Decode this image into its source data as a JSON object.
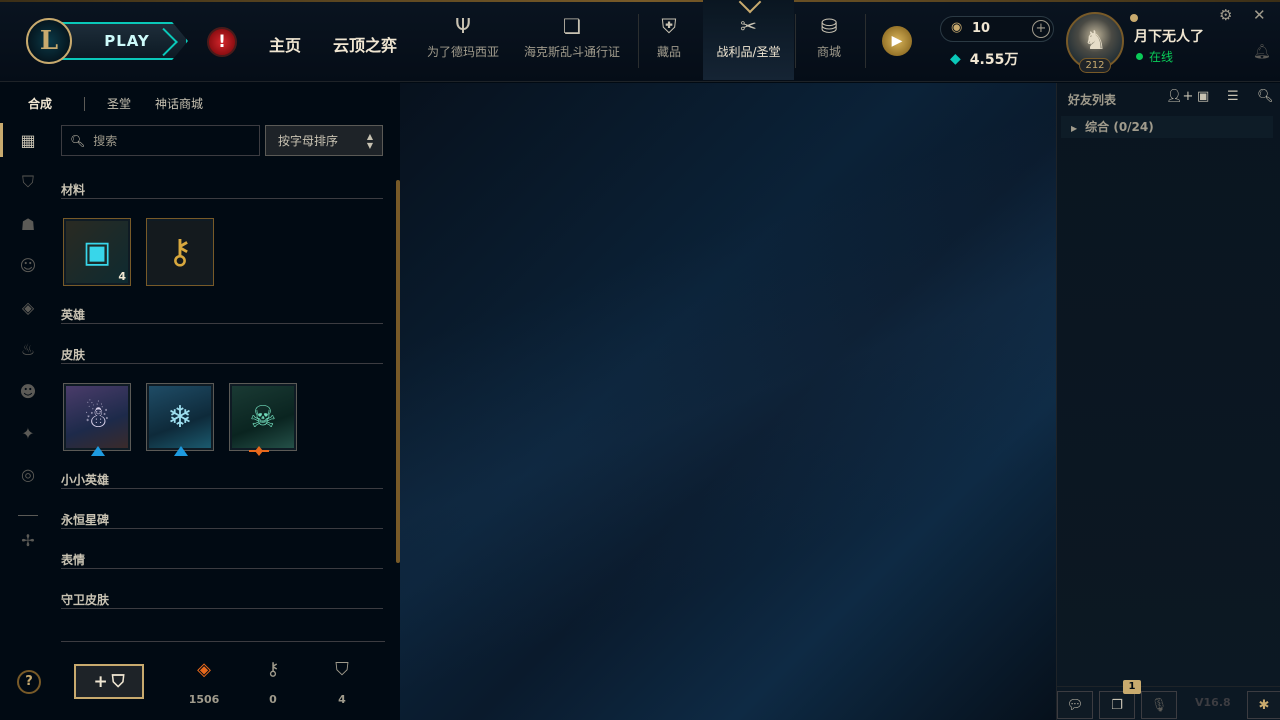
{
  "header": {
    "play_label": "PLAY",
    "alert_glyph": "!",
    "nav_main": [
      "主页",
      "云顶之弈"
    ],
    "nav_sub": [
      {
        "label": "为了德玛西亚",
        "icon": "trident-icon"
      },
      {
        "label": "海克斯乱斗通行证",
        "icon": "pass-icon"
      },
      {
        "label": "藏品",
        "icon": "collection-icon"
      },
      {
        "label": "战利品/圣堂",
        "icon": "loot-icon",
        "active": true
      },
      {
        "label": "商城",
        "icon": "store-icon"
      }
    ],
    "currency": {
      "rp": "10",
      "blue_essence": "4.55万"
    },
    "user": {
      "name": "月下无人了",
      "status": "在线",
      "level": "212"
    }
  },
  "loot": {
    "subtabs": [
      "合成",
      "圣堂",
      "神话商城"
    ],
    "search_placeholder": "搜索",
    "sort_label": "按字母排序",
    "categories": [
      "材料",
      "英雄",
      "皮肤",
      "小小英雄",
      "永恒星碑",
      "表情",
      "守卫皮肤"
    ],
    "materials": [
      {
        "name": "hextech-chest",
        "count": "4"
      },
      {
        "name": "hextech-key",
        "count": ""
      }
    ],
    "skins": [
      {
        "name": "skin-1",
        "rarity": "blue"
      },
      {
        "name": "skin-2",
        "rarity": "blue"
      },
      {
        "name": "skin-3",
        "rarity": "orange"
      }
    ],
    "resources": {
      "orange_essence": "1506",
      "key_fragments": "0",
      "chests": "4"
    },
    "help_glyph": "?"
  },
  "friends": {
    "title": "好友列表",
    "group": "综合 (0/24)",
    "notification_count": "1",
    "version": "V16.8"
  },
  "colors": {
    "gold": "#c8aa6e",
    "teal": "#0ac8b9",
    "online": "#0acb58"
  }
}
